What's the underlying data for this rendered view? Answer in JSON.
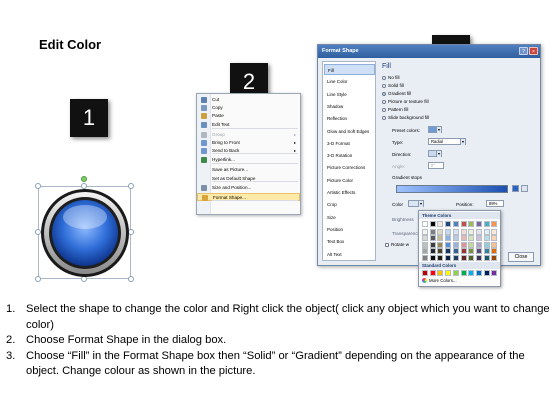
{
  "title": "Edit Color",
  "badges": [
    "1",
    "2",
    "3"
  ],
  "context_menu": {
    "items": [
      {
        "label": "Cut",
        "icon": "scissors-icon",
        "color": "#5a7fb0"
      },
      {
        "label": "Copy",
        "icon": "copy-icon",
        "color": "#7a9ac2"
      },
      {
        "label": "Paste",
        "icon": "paste-icon",
        "color": "#c9a23f"
      },
      {
        "label": "Edit Text",
        "icon": "edit-text-icon",
        "color": "#6b8fbf"
      },
      {
        "label": "Group",
        "icon": "group-icon",
        "color": "#b0b7c0",
        "dim": true,
        "submenu": true
      },
      {
        "label": "Bring to Front",
        "icon": "bring-front-icon",
        "color": "#6f98d0",
        "submenu": true
      },
      {
        "label": "Send to Back",
        "icon": "send-back-icon",
        "color": "#6f98d0",
        "submenu": true
      },
      {
        "label": "Hyperlink...",
        "icon": "hyperlink-icon",
        "color": "#3f8a4a"
      },
      {
        "label": "Save as Picture...",
        "icon": "",
        "color": ""
      },
      {
        "label": "Set as Default Shape",
        "icon": "",
        "color": ""
      },
      {
        "label": "Size and Position...",
        "icon": "size-position-icon",
        "color": "#7c8fa8"
      },
      {
        "label": "Format Shape...",
        "icon": "format-shape-icon",
        "color": "#d9a23a",
        "highlight": true
      }
    ]
  },
  "dialog": {
    "title": "Format Shape",
    "help": "?",
    "close_x": "×",
    "nav": [
      "Fill",
      "Line Color",
      "Line Style",
      "Shadow",
      "Reflection",
      "Glow and Soft Edges",
      "3-D Format",
      "3-D Rotation",
      "Picture Corrections",
      "Picture Color",
      "Artistic Effects",
      "Crop",
      "Size",
      "Position",
      "Text Box",
      "Alt Text"
    ],
    "section": "Fill",
    "fill_options": [
      {
        "label": "No fill",
        "on": false
      },
      {
        "label": "Solid fill",
        "on": false
      },
      {
        "label": "Gradient fill",
        "on": true
      },
      {
        "label": "Picture or texture fill",
        "on": false
      },
      {
        "label": "Pattern fill",
        "on": false
      },
      {
        "label": "Slide background fill",
        "on": false
      }
    ],
    "preset_colors": "Preset colors:",
    "type_label": "Type:",
    "type_value": "Radial",
    "direction_label": "Direction:",
    "angle_label": "Angle:",
    "angle_value": "0°",
    "gradient_stops": "Gradient stops",
    "color_label": "Color",
    "position_label": "Position:",
    "position_value": "89%",
    "brightness_label": "Brightness",
    "transparency_label": "Transparency",
    "rotate_label": "Rotate w",
    "close_button": "Close"
  },
  "palette": {
    "theme_title": "Theme Colors",
    "standard_title": "Standard Colors",
    "more": "More Colors...",
    "theme_top": [
      "#ffffff",
      "#000000",
      "#eeece1",
      "#1f497d",
      "#4f81bd",
      "#c0504d",
      "#9bbb59",
      "#8064a2",
      "#4bacc6",
      "#f79646"
    ],
    "theme_shades": [
      [
        "#f2f2f2",
        "#7f7f7f",
        "#ddd9c3",
        "#c6d9f0",
        "#dbe5f1",
        "#f2dcdb",
        "#ebf1dd",
        "#e5e0ec",
        "#dbeef3",
        "#fdeada"
      ],
      [
        "#d8d8d8",
        "#595959",
        "#c4bd97",
        "#8db3e2",
        "#b8cce4",
        "#e5b9b7",
        "#d7e3bc",
        "#ccc1d9",
        "#b7dde8",
        "#fbd5b5"
      ],
      [
        "#bfbfbf",
        "#3f3f3f",
        "#938953",
        "#548dd4",
        "#95b3d7",
        "#d99694",
        "#c3d69b",
        "#b2a2c7",
        "#92cddc",
        "#fac08f"
      ],
      [
        "#a5a5a5",
        "#262626",
        "#494429",
        "#17365d",
        "#366092",
        "#953734",
        "#76923c",
        "#5f497a",
        "#31859b",
        "#e36c09"
      ],
      [
        "#7f7f7f",
        "#0c0c0c",
        "#1d1b10",
        "#0f243e",
        "#244061",
        "#632423",
        "#4f6128",
        "#3f3151",
        "#205867",
        "#974806"
      ]
    ],
    "standard": [
      "#c00000",
      "#ff0000",
      "#ffc000",
      "#ffff00",
      "#92d050",
      "#00b050",
      "#00b0f0",
      "#0070c0",
      "#002060",
      "#7030a0"
    ]
  },
  "instructions": [
    {
      "num": "1.",
      "text": "Select the shape to change the color and Right click the object( click any object which you want to change color)"
    },
    {
      "num": "2.",
      "text": "Choose Format Shape in the dialog box."
    },
    {
      "num": "3.",
      "text": "Choose “Fill” in the Format Shape box then “Solid” or “Gradient” depending on the appearance of the object. Change colour as shown in the picture."
    }
  ]
}
